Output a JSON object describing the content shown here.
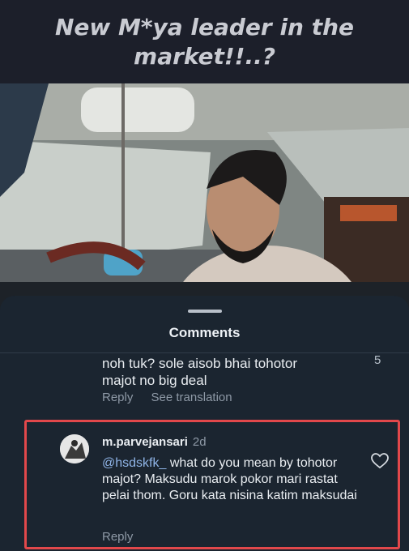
{
  "caption": {
    "line1": "New M*ya leader in the",
    "line2": "market!!..?"
  },
  "sheet": {
    "title": "Comments"
  },
  "comment_prev": {
    "text_line1": "noh tuk? sole aisob bhai tohotor",
    "text_line2": "majot no big deal",
    "reply_label": "Reply",
    "translate_label": "See translation",
    "like_count": "5"
  },
  "comment_highlight": {
    "username": "m.parvejansari",
    "time": "2d",
    "mention": "@hsdskfk_",
    "text": " what do you mean by tohotor majot? Maksudu marok pokor mari rastat pelai thom. Goru kata nisina katim maksudai",
    "reply_label": "Reply",
    "highlight_color": "#e2484b"
  }
}
